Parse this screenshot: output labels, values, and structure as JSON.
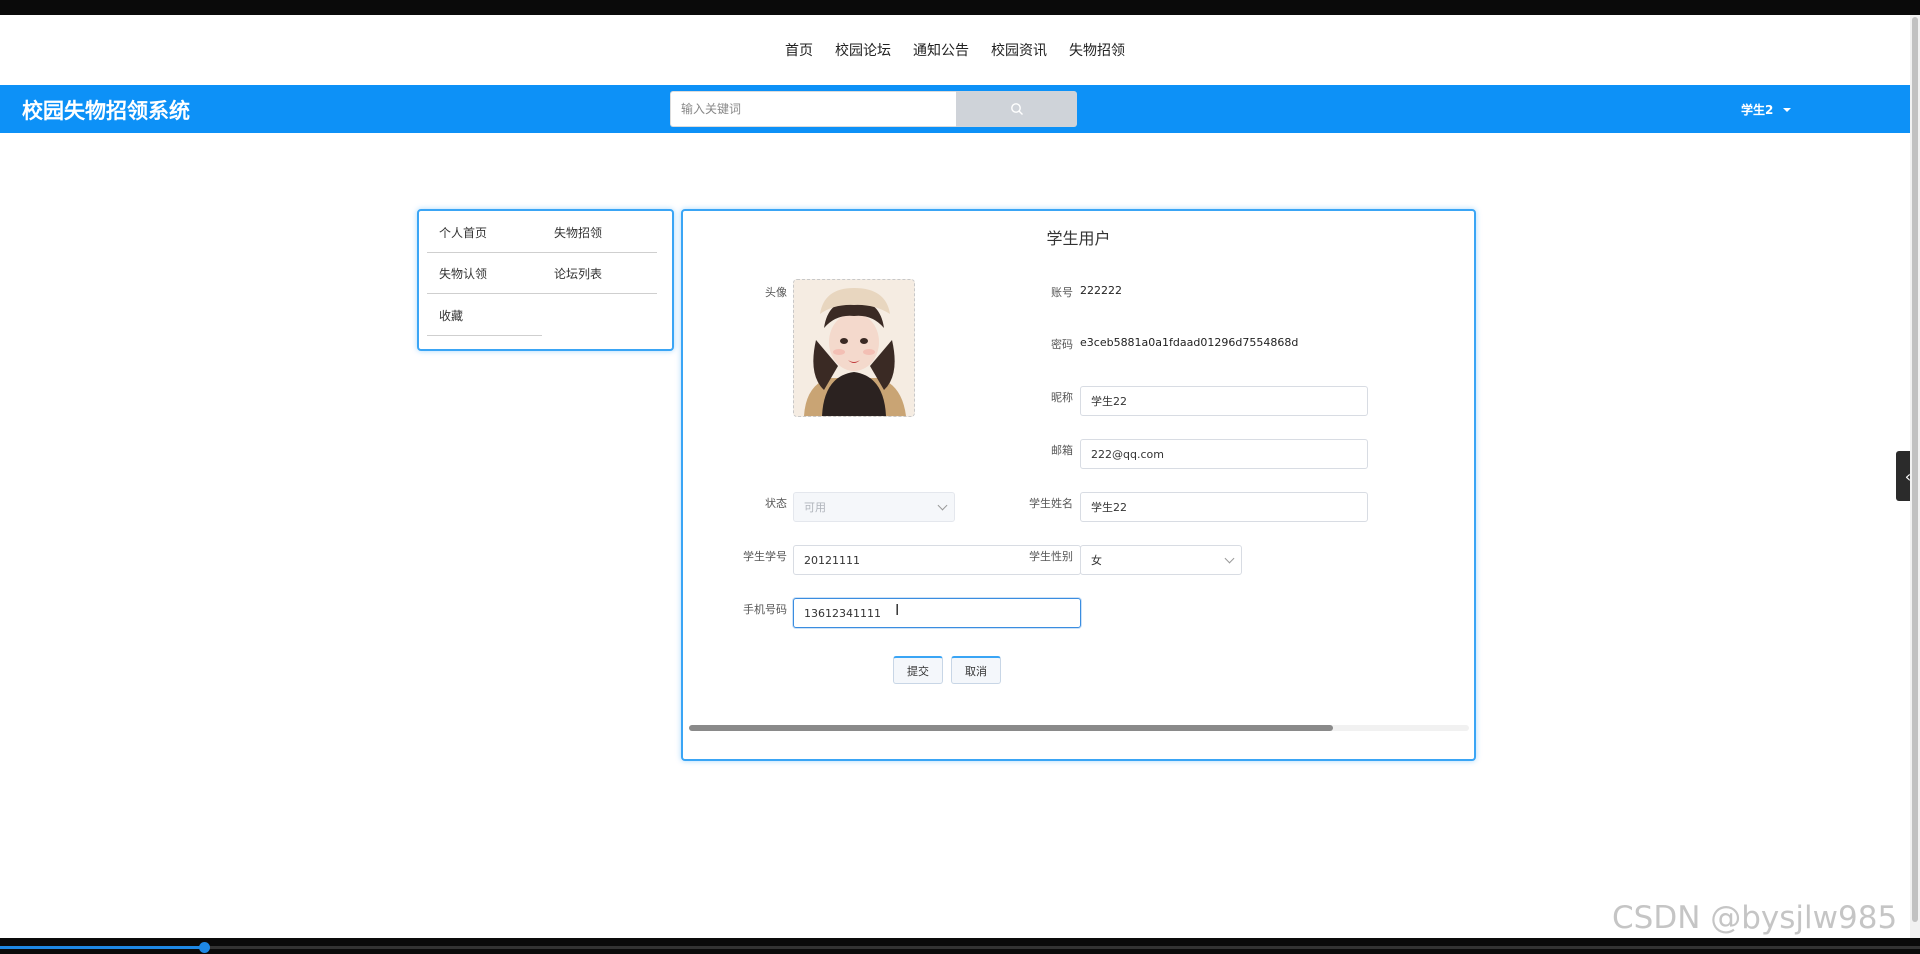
{
  "top_nav": {
    "items": [
      "首页",
      "校园论坛",
      "通知公告",
      "校园资讯",
      "失物招领"
    ]
  },
  "header": {
    "brand": "校园失物招领系统",
    "search_placeholder": "输入关键词",
    "user": "学生2"
  },
  "side_menu": {
    "items": [
      "个人首页",
      "失物招领",
      "失物认领",
      "论坛列表",
      "收藏"
    ]
  },
  "form": {
    "title": "学生用户",
    "avatar_label": "头像",
    "account_label": "账号",
    "account_value": "222222",
    "password_label": "密码",
    "password_value": "e3ceb5881a0a1fdaad01296d7554868d",
    "nickname_label": "昵称",
    "nickname_value": "学生22",
    "email_label": "邮箱",
    "email_value": "222@qq.com",
    "status_label": "状态",
    "status_value": "可用",
    "student_name_label": "学生姓名",
    "student_name_value": "学生22",
    "student_id_label": "学生学号",
    "student_id_value": "20121111",
    "gender_label": "学生性别",
    "gender_value": "女",
    "phone_label": "手机号码",
    "phone_value": "13612341111",
    "submit_label": "提交",
    "cancel_label": "取消"
  },
  "watermark": "CSDN @bysjlw985",
  "colors": {
    "header_blue": "#0d91f7",
    "panel_border": "#3aa5f5"
  }
}
